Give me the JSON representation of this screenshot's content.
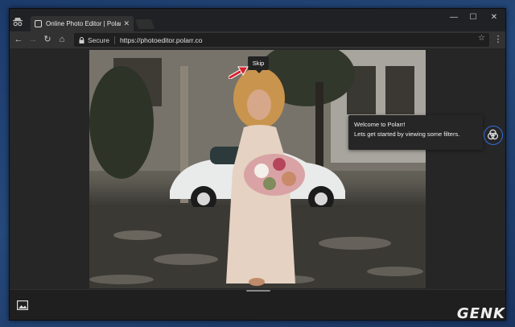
{
  "browser": {
    "tab_title": "Online Photo Editor | Polarr",
    "secure_label": "Secure",
    "url": "https://photoeditor.polarr.co"
  },
  "onboarding": {
    "skip_label": "Skip",
    "tooltip_title": "Welcome to Polarr!",
    "tooltip_body": "Lets get started by viewing some filters."
  },
  "watermark": "GENK",
  "colors": {
    "accent": "#2f6fe0",
    "arrow": "#d8212b"
  },
  "icons": [
    "incognito-icon",
    "close-icon",
    "minimize-icon",
    "maximize-icon",
    "back-icon",
    "forward-icon",
    "reload-icon",
    "home-icon",
    "lock-icon",
    "star-icon",
    "menu-icon",
    "image-icon",
    "filter-icon"
  ]
}
